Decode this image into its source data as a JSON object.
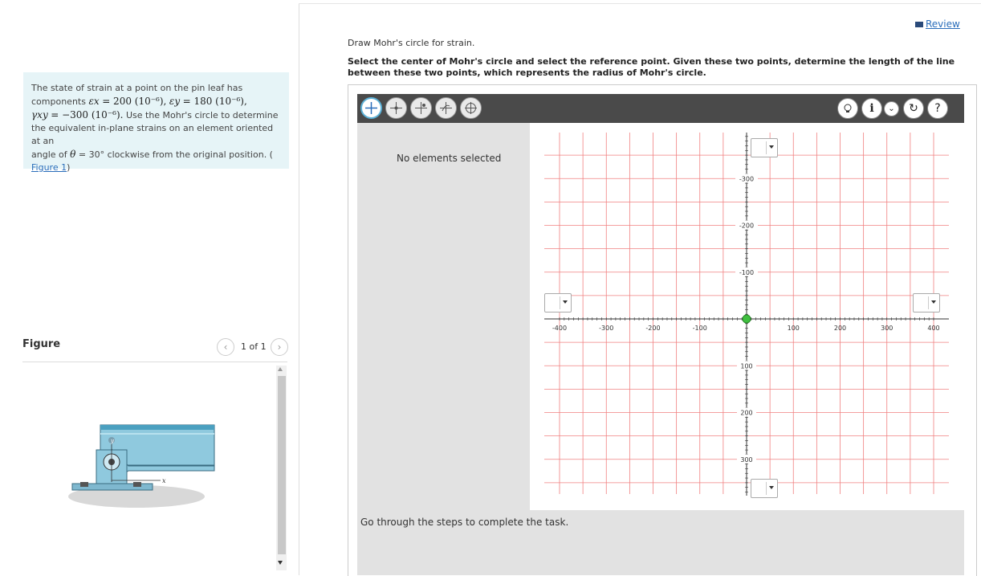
{
  "review": {
    "label": "Review"
  },
  "problem": {
    "p1": "The state of strain at a point on the pin leaf has",
    "p2": "components",
    "ex_sym": "εx",
    "ex_val": "= 200 (10⁻⁶),",
    "ey_sym": "εy",
    "ey_val": "= 180 (10⁻⁶),",
    "gxy_sym": "γxy",
    "gxy_val": "= −300 (10⁻⁶).",
    "p3": "Use the Mohr's circle to determine",
    "p4": "the equivalent in-plane strains on an element oriented at an",
    "p5a": "angle of",
    "theta": "θ",
    "p5b": "= 30° clockwise from the original position. (",
    "figure_link": "Figure 1",
    "p6": ")"
  },
  "figure": {
    "label": "Figure",
    "pager": "1 of 1",
    "prev_icon": "chevron-left",
    "next_icon": "chevron-right",
    "axis_y_letter": "y",
    "axis_x_letter": "x"
  },
  "instructions": {
    "line1": "Draw Mohr's circle for strain.",
    "line2": "Select the center of Mohr's circle and select the reference point. Given these two points, determine the length of the line between these two points, which represents the radius of Mohr's circle."
  },
  "toolbar": {
    "tools": [
      "point-tool-icon",
      "center-point-tool-icon",
      "reference-point-tool-icon",
      "rotate-tool-icon",
      "circle-tool-icon"
    ],
    "right_icons": [
      "hint-bulb-icon",
      "info-icon",
      "chevron-down-icon",
      "reset-icon",
      "help-icon"
    ]
  },
  "side_panel": {
    "status": "No elements selected"
  },
  "bottom": {
    "message": "Go through the steps to complete the task."
  },
  "graph": {
    "x_ticks": [
      "-400",
      "-300",
      "-200",
      "-100",
      "100",
      "200",
      "300",
      "400"
    ],
    "y_ticks_above": [
      "-300",
      "-200",
      "-100"
    ],
    "y_ticks_below": [
      "100",
      "200",
      "300"
    ],
    "origin_marker_color": "#3fbf3f",
    "grid_color": "#f08080"
  },
  "colors": {
    "problem_bg": "#e6f4f7",
    "toolbar_bg": "#4a4a4a",
    "link": "#2a6ebb"
  }
}
